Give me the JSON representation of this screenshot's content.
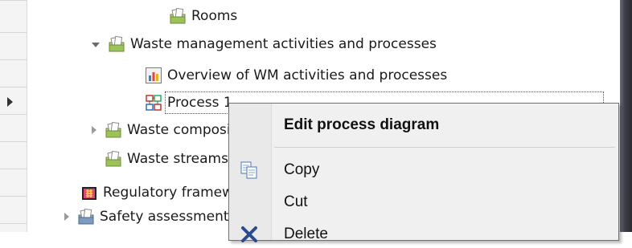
{
  "tree": {
    "items": [
      {
        "label": "Rooms",
        "icon": "folder-pages-icon"
      },
      {
        "label": "Waste management activities and processes",
        "icon": "folder-pages-icon",
        "expander": "expanded"
      },
      {
        "label": "Overview of WM activities and processes",
        "icon": "bar-chart-icon"
      },
      {
        "label": "Process 1",
        "icon": "process-diagram-icon",
        "selected": true
      },
      {
        "label": "Waste compositions",
        "icon": "folder-pages-icon",
        "expander": "collapsed"
      },
      {
        "label": "Waste streams",
        "icon": "folder-pages-icon"
      },
      {
        "label": "Regulatory framework",
        "icon": "regulatory-icon"
      },
      {
        "label": "Safety assessment",
        "icon": "folder-pages-icon",
        "expander": "collapsed"
      }
    ]
  },
  "context_menu": {
    "items": [
      {
        "label": "Edit process diagram",
        "default": true
      },
      {
        "label": "Copy",
        "icon": "copy-icon"
      },
      {
        "label": "Cut"
      },
      {
        "label": "Delete",
        "icon": "delete-icon"
      }
    ]
  }
}
